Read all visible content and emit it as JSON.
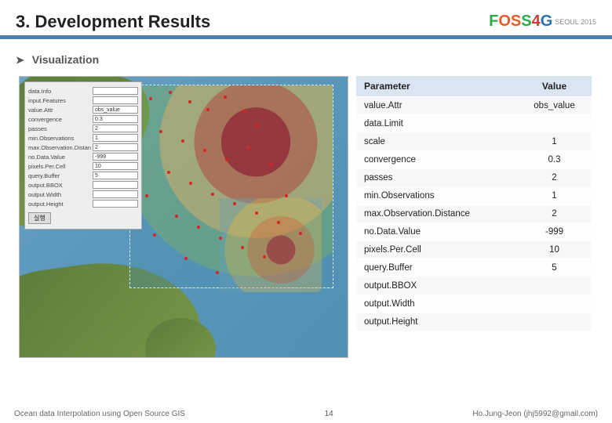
{
  "header": {
    "title": "3. Development Results",
    "logo": {
      "text": "FOSS4G",
      "sub": "SEOUL 2015"
    }
  },
  "section": {
    "arrow": "➤",
    "label": "Visualization"
  },
  "panel": {
    "header": "",
    "rows": [
      {
        "label": "data.Info",
        "value": ""
      },
      {
        "label": "input.Features",
        "value": ""
      },
      {
        "label": "value.Attr",
        "value": "obs_value"
      },
      {
        "label": "convergence",
        "value": "0.3"
      },
      {
        "label": "passes",
        "value": "2"
      },
      {
        "label": "min.Observations",
        "value": "1"
      },
      {
        "label": "max.Observation.Distance",
        "value": "2"
      },
      {
        "label": "no.Data.Value",
        "value": "-999"
      },
      {
        "label": "pixels.Per.Cell",
        "value": "10"
      },
      {
        "label": "query.Buffer",
        "value": "5"
      },
      {
        "label": "output.BBOX",
        "value": ""
      },
      {
        "label": "output.Width",
        "value": ""
      },
      {
        "label": "output.Height",
        "value": ""
      }
    ],
    "button": "실행"
  },
  "table": {
    "headers": {
      "param": "Parameter",
      "value": "Value"
    },
    "rows": [
      {
        "param": "value.Attr",
        "value": "obs_value"
      },
      {
        "param": "data.Limit",
        "value": ""
      },
      {
        "param": "scale",
        "value": "1"
      },
      {
        "param": "convergence",
        "value": "0.3"
      },
      {
        "param": "passes",
        "value": "2"
      },
      {
        "param": "min.Observations",
        "value": "1"
      },
      {
        "param": "max.Observation.Distance",
        "value": "2"
      },
      {
        "param": "no.Data.Value",
        "value": "-999"
      },
      {
        "param": "pixels.Per.Cell",
        "value": "10"
      },
      {
        "param": "query.Buffer",
        "value": "5"
      },
      {
        "param": "output.BBOX",
        "value": ""
      },
      {
        "param": "output.Width",
        "value": ""
      },
      {
        "param": "output.Height",
        "value": ""
      }
    ]
  },
  "footer": {
    "left": "Ocean data Interpolation using Open Source GIS",
    "page": "14",
    "right": "Ho.Jung-Jeon (jhj5992@gmail.com)"
  }
}
